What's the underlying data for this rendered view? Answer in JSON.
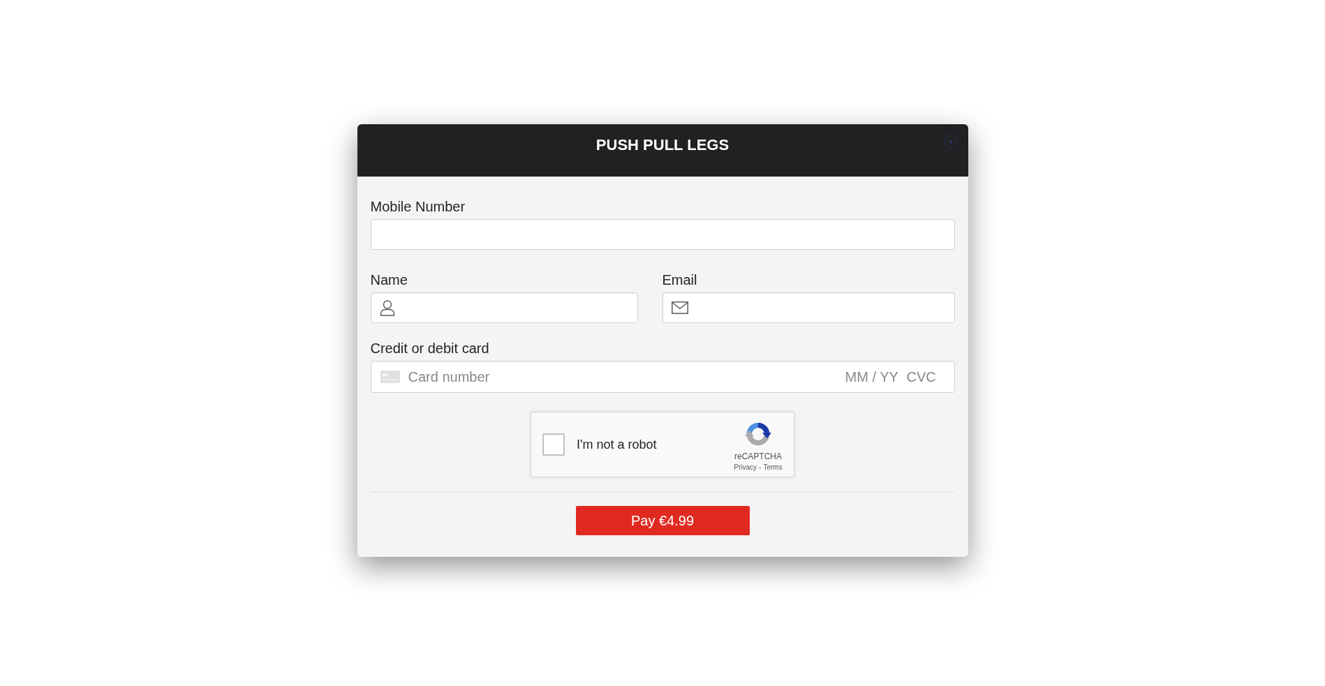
{
  "modal": {
    "title": "PUSH PULL LEGS"
  },
  "form": {
    "rows": [
      {
        "fields": [
          {
            "kind": "plain",
            "label": "Mobile Number"
          }
        ]
      },
      {
        "fields": [
          {
            "kind": "person",
            "label": "Name"
          },
          {
            "kind": "mail",
            "label": "Email"
          }
        ]
      }
    ],
    "card": {
      "label": "Credit or debit card",
      "inputs": [
        {
          "kind": "number",
          "placeholder": "Card number"
        },
        {
          "kind": "expiry",
          "placeholder": "MM / YY"
        },
        {
          "kind": "cvc",
          "placeholder": "CVC"
        }
      ]
    }
  },
  "captcha": {
    "checked": false,
    "label": "I'm not a robot",
    "brand": "reCAPTCHA",
    "links": [
      "Privacy",
      "Terms"
    ],
    "separator": "-"
  },
  "pay_button": {
    "label": "Pay €4.99"
  }
}
